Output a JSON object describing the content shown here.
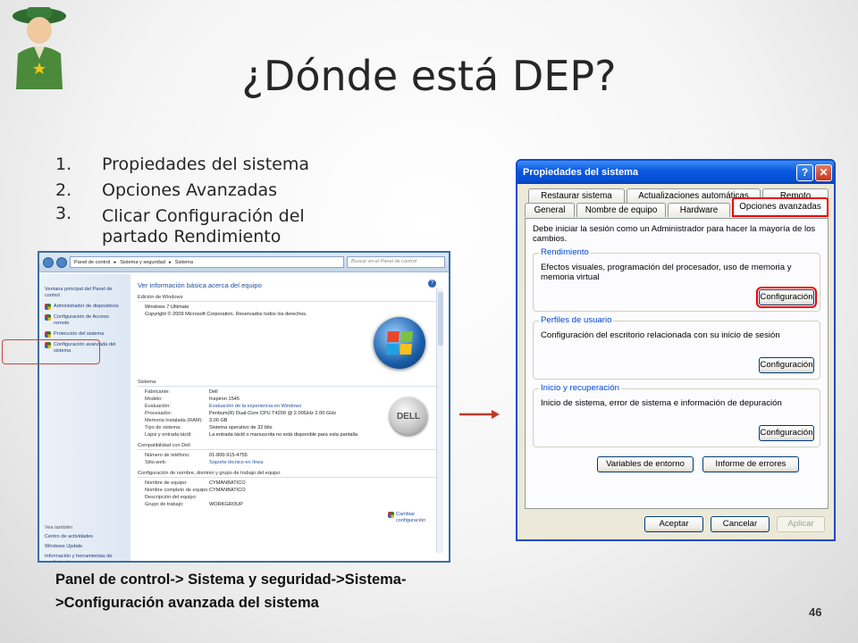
{
  "slide": {
    "title": "¿Dónde está DEP?",
    "page_number": "46",
    "steps": [
      {
        "num": "1.",
        "text": "Propiedades del sistema"
      },
      {
        "num": "2.",
        "text": "Opciones Avanzadas"
      },
      {
        "num": "3.",
        "text": "Clicar  Configuración del partado Rendimiento"
      }
    ],
    "caption": "Panel de control-> Sistema y seguridad->Sistema->Configuración avanzada del sistema",
    "colors": {
      "highlight": "#ee0000",
      "arrow": "#c0392b",
      "xp_blue": "#0a57df"
    }
  },
  "control_panel": {
    "path": [
      "Panel de control",
      "Sistema y seguridad",
      "Sistema"
    ],
    "search_placeholder": "Buscar en el Panel de control",
    "sidebar": {
      "home": "Ventana principal del Panel de control",
      "items": [
        "Administrador de dispositivos",
        "Configuración de Acceso remoto",
        "Protección del sistema",
        "Configuración avanzada del sistema"
      ],
      "see_also_label": "Vea también",
      "see_also": [
        "Centro de actividades",
        "Windows Update",
        "Información y herramientas de rendimiento"
      ]
    },
    "main": {
      "heading": "Ver información básica acerca del equipo",
      "edition_section": "Edición de Windows",
      "edition": "Windows 7 Ultimate",
      "copyright": "Copyright © 2009 Microsoft Corporation. Reservados todos los derechos.",
      "system_section": "Sistema",
      "system_rows": [
        {
          "k": "Fabricante:",
          "v": "Dell"
        },
        {
          "k": "Modelo:",
          "v": "Inspiron 1545"
        },
        {
          "k": "Evaluación:",
          "v": "Evaluación de la experiencia en Windows",
          "link": true
        },
        {
          "k": "Procesador:",
          "v": "Pentium(R) Dual-Core CPU      T4200  @ 2.00GHz   2.00 GHz"
        },
        {
          "k": "Memoria instalada (RAM):",
          "v": "3,00 GB"
        },
        {
          "k": "Tipo de sistema:",
          "v": "Sistema operativo de 32 bits"
        },
        {
          "k": "Lápiz y entrada táctil:",
          "v": "La entrada táctil o manuscrita no está disponible para esta pantalla"
        }
      ],
      "dell_section": "Compatibilidad con Dell",
      "dell_rows": [
        {
          "k": "Número de teléfono:",
          "v": "01-800-915-4755"
        },
        {
          "k": "Sitio web:",
          "v": "Soporte técnico en línea",
          "link": true
        }
      ],
      "name_section": "Configuración de nombre, dominio y grupo de trabajo del equipo",
      "name_rows": [
        {
          "k": "Nombre de equipo:",
          "v": "CYMANBATICO"
        },
        {
          "k": "Nombre completo de equipo:",
          "v": "CYMANBATICO"
        },
        {
          "k": "Descripción del equipo:",
          "v": ""
        },
        {
          "k": "Grupo de trabajo:",
          "v": "WORKGROUP"
        }
      ],
      "change_settings": "Cambiar configuración",
      "dell_logo": "DELL"
    }
  },
  "dialog": {
    "title": "Propiedades del sistema",
    "help_glyph": "?",
    "close_glyph": "✕",
    "tabs_row1": [
      "Restaurar sistema",
      "Actualizaciones automáticas",
      "Remoto"
    ],
    "tabs_row2": [
      "General",
      "Nombre de equipo",
      "Hardware",
      "Opciones avanzadas"
    ],
    "note": "Debe iniciar la sesión como un Administrador para hacer la mayoría de los cambios.",
    "groups": [
      {
        "legend": "Rendimiento",
        "desc": "Efectos visuales, programación del procesador, uso de memoria y memoria virtual",
        "button": "Configuración"
      },
      {
        "legend": "Perfiles de usuario",
        "desc": "Configuración del escritorio relacionada con su inicio de sesión",
        "button": "Configuración"
      },
      {
        "legend": "Inicio y recuperación",
        "desc": "Inicio de sistema, error de sistema e información de depuración",
        "button": "Configuración"
      }
    ],
    "env_button": "Variables de entorno",
    "errors_button": "Informe de errores",
    "ok_button": "Aceptar",
    "cancel_button": "Cancelar",
    "apply_button": "Aplicar"
  }
}
